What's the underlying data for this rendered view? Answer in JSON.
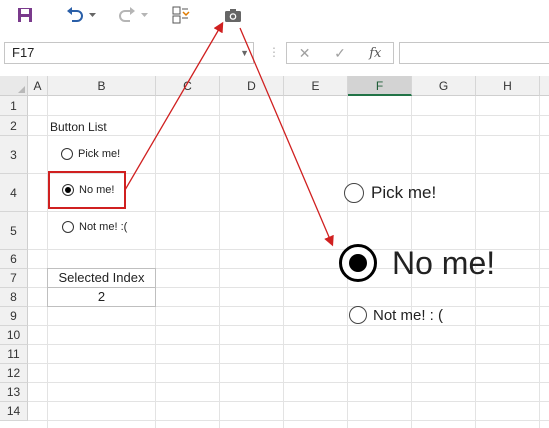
{
  "toolbar": {
    "icons": [
      "save-icon",
      "undo-icon",
      "undo-dropdown-icon",
      "redo-icon",
      "redo-dropdown-icon",
      "form-controls-icon",
      "camera-icon"
    ]
  },
  "formula_bar": {
    "name_box": "F17",
    "cancel_glyph": "✕",
    "enter_glyph": "✓",
    "fx_label": "fx",
    "formula": ""
  },
  "columns": [
    "A",
    "B",
    "C",
    "D",
    "E",
    "F",
    "G",
    "H"
  ],
  "active_column": "F",
  "rows": [
    "1",
    "2",
    "3",
    "4",
    "5",
    "6",
    "7",
    "8",
    "9",
    "10",
    "11",
    "12",
    "13",
    "14"
  ],
  "sheet": {
    "list_title": "Button List",
    "options": [
      "Pick me!",
      "No me!",
      "Not me! :("
    ],
    "selected_option": "No me!",
    "table_header": "Selected Index",
    "table_value": "2"
  },
  "picture": {
    "options": [
      "Pick me!",
      "No me!",
      "Not me! : ("
    ],
    "selected_option": "No me!"
  },
  "colors": {
    "annotation_red": "#d02020",
    "excel_green": "#217346",
    "save_purple": "#7a3a8c",
    "undo_blue": "#2a5fa8"
  }
}
